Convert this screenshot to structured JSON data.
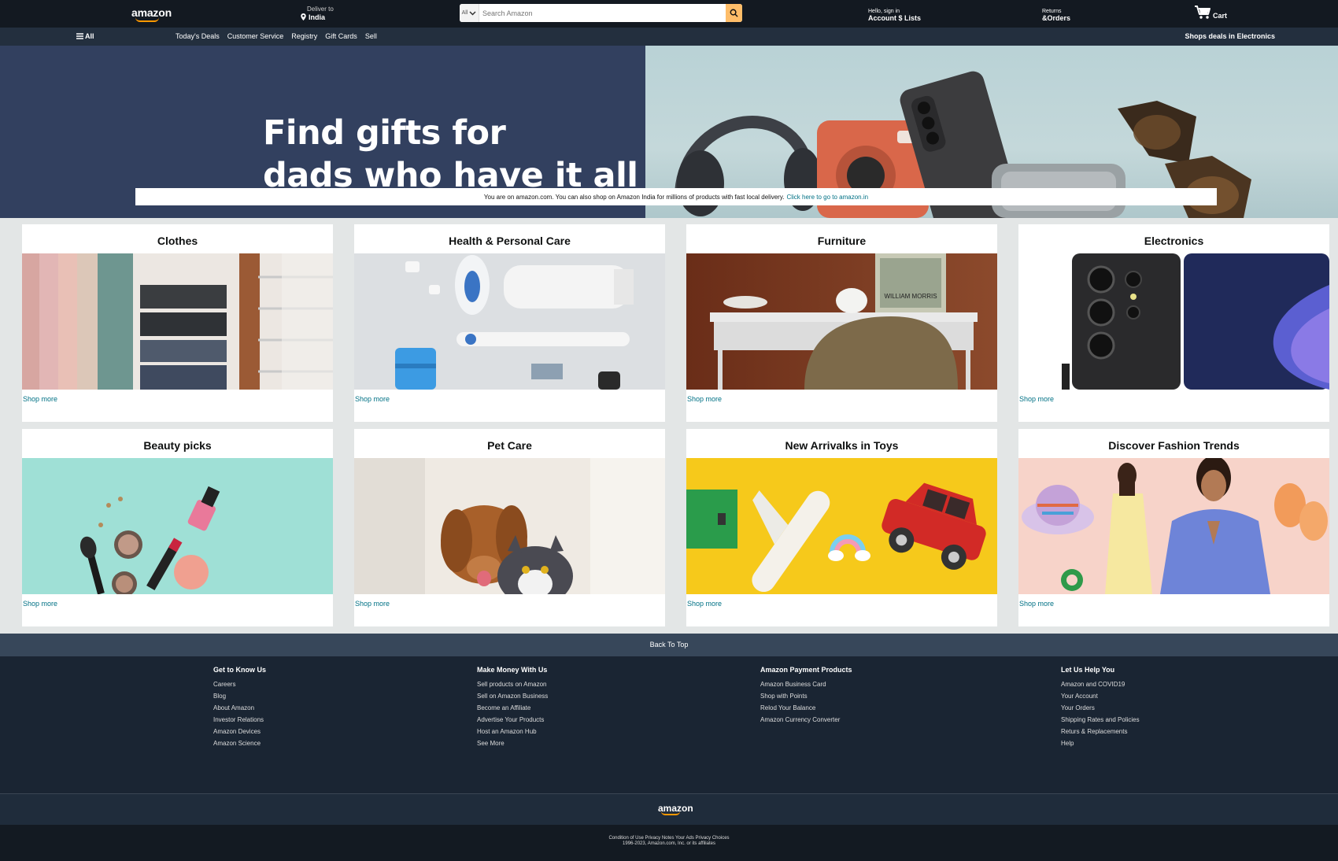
{
  "header": {
    "logo": "amazon",
    "deliver_label": "Deliver to",
    "deliver_location": "India",
    "search_category": "All",
    "search_placeholder": "Search Amazon",
    "account_greeting": "Hello, sign in",
    "account_label": "Account $ Lists",
    "returns_label": "Returns",
    "orders_label": "&Orders",
    "cart_label": "Cart"
  },
  "subnav": {
    "all_label": "All",
    "links": [
      "Today's Deals",
      "Customer Service",
      "Registry",
      "Gift Cards",
      "Sell"
    ],
    "promo": "Shops deals in Electronics"
  },
  "hero": {
    "title_line1": "Find gifts for",
    "title_line2": "dads who have it all",
    "banner_text": "You are on amazon.com. You can also shop on Amazon India for millions of products with fast local delivery.",
    "banner_link": "Click here to go to amazon.in"
  },
  "cards": [
    {
      "title": "Clothes",
      "link": "Shop more"
    },
    {
      "title": "Health & Personal Care",
      "link": "Shop more"
    },
    {
      "title": "Furniture",
      "link": "Shop more"
    },
    {
      "title": "Electronics",
      "link": "Shop more"
    },
    {
      "title": "Beauty picks",
      "link": "Shop more"
    },
    {
      "title": "Pet Care",
      "link": "Shop more"
    },
    {
      "title": "New Arrivalks in Toys",
      "link": "Shop more"
    },
    {
      "title": "Discover Fashion Trends",
      "link": "Shop more"
    }
  ],
  "furniture_poster_text": "WILLIAM MORRIS",
  "footer": {
    "back_to_top": "Back To Top",
    "columns": [
      {
        "heading": "Get to Know Us",
        "links": [
          "Careers",
          "Blog",
          "About Amazon",
          "Investor Relations",
          "Amazon Devices",
          "Amazon Science"
        ]
      },
      {
        "heading": "Make Money With Us",
        "links": [
          "Sell products on Amazon",
          "Sell on Amazon Business",
          "Become an Affiliate",
          "Advertise Your Products",
          "Host an Amazon Hub",
          "See More"
        ]
      },
      {
        "heading": "Amazon Payment Products",
        "links": [
          "Amazon Business Card",
          "Shop with Points",
          "Relod Your Balance",
          "Amazon Currency Converter"
        ]
      },
      {
        "heading": "Let Us Help You",
        "links": [
          "Amazon and COVID19",
          "Your Account",
          "Your Orders",
          "Shipping Rates and Policies",
          "Returs & Replacements",
          "Help"
        ]
      }
    ],
    "logo": "amazon",
    "legal_line1": "Condition of Use Privacy Notes Your Ads Privacy Choices",
    "legal_line2": "1996-2023, Amazon.com, Inc. or its affiliates"
  },
  "colors": {
    "header_bg": "#131921",
    "subnav_bg": "#232f3e",
    "search_button": "#febd69",
    "accent": "#ff9900",
    "link": "#007185",
    "hero_left": "#32405f"
  }
}
